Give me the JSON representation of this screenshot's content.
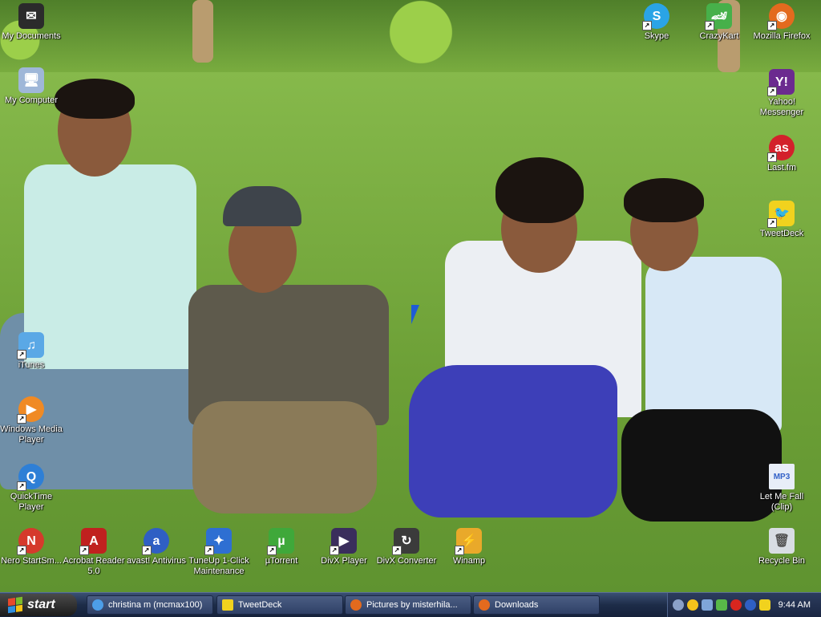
{
  "desktop_icons": [
    {
      "id": "my-documents",
      "label": "My Documents",
      "icon": "folder-icon",
      "color": "#2b2b2b"
    },
    {
      "id": "my-computer",
      "label": "My Computer",
      "icon": "computer-icon",
      "color": "#9fb7d8"
    },
    {
      "id": "itunes",
      "label": "iTunes",
      "icon": "itunes-icon",
      "color": "#5aa8e6"
    },
    {
      "id": "wmp",
      "label": "Windows Media Player",
      "icon": "media-player-icon",
      "color": "#f08a24"
    },
    {
      "id": "quicktime",
      "label": "QuickTime Player",
      "icon": "quicktime-icon",
      "color": "#2e7fd6"
    },
    {
      "id": "nero",
      "label": "Nero StartSm...",
      "icon": "nero-icon",
      "color": "#d53a2c"
    },
    {
      "id": "acrobat",
      "label": "Acrobat Reader 5.0",
      "icon": "acrobat-icon",
      "color": "#c0211f"
    },
    {
      "id": "avast",
      "label": "avast! Antivirus",
      "icon": "avast-icon",
      "color": "#2f5fc4"
    },
    {
      "id": "tuneup",
      "label": "TuneUp 1-Click Maintenance",
      "icon": "tuneup-icon",
      "color": "#2e6fd2"
    },
    {
      "id": "utorrent",
      "label": "µTorrent",
      "icon": "utorrent-icon",
      "color": "#3fa83a"
    },
    {
      "id": "divx-player",
      "label": "DivX Player",
      "icon": "divx-player-icon",
      "color": "#3a2e5c"
    },
    {
      "id": "divx-converter",
      "label": "DivX Converter",
      "icon": "divx-converter-icon",
      "color": "#3b3b3b"
    },
    {
      "id": "winamp",
      "label": "Winamp",
      "icon": "winamp-icon",
      "color": "#e9a92a"
    },
    {
      "id": "skype",
      "label": "Skype",
      "icon": "skype-icon",
      "color": "#2aa4e6"
    },
    {
      "id": "crazykart",
      "label": "CrazyKart",
      "icon": "kart-icon",
      "color": "#47b04a"
    },
    {
      "id": "firefox",
      "label": "Mozilla Firefox",
      "icon": "firefox-icon",
      "color": "#e36a1e"
    },
    {
      "id": "yahoo",
      "label": "Yahoo! Messenger",
      "icon": "yahoo-messenger-icon",
      "color": "#6b2a8f"
    },
    {
      "id": "lastfm",
      "label": "Last.fm",
      "icon": "lastfm-icon",
      "color": "#d3212b"
    },
    {
      "id": "tweetdeck",
      "label": "TweetDeck",
      "icon": "tweetdeck-icon",
      "color": "#f1d21e"
    },
    {
      "id": "mp3",
      "label": "Let Me Fall (Clip)",
      "icon": "mp3-file-icon",
      "color": "#e8eef8"
    },
    {
      "id": "recycle",
      "label": "Recycle Bin",
      "icon": "recycle-bin-icon",
      "color": "#d8dde3"
    }
  ],
  "taskbar": {
    "start_label": "start",
    "tasks": [
      {
        "label": "christina m (mcmax100)",
        "icon": "messenger-icon",
        "color": "#4d9ee8"
      },
      {
        "label": "TweetDeck",
        "icon": "tweetdeck-icon",
        "color": "#f1d21e"
      },
      {
        "label": "Pictures by misterhila...",
        "icon": "firefox-icon",
        "color": "#e36a1e"
      },
      {
        "label": "Downloads",
        "icon": "firefox-icon",
        "color": "#e36a1e"
      }
    ],
    "tray_icons": [
      "show-hidden-icon",
      "messenger-tray-icon",
      "network-icon",
      "tuneup-tray-icon",
      "antivirus-tray-icon",
      "avast-tray-icon",
      "tweetdeck-tray-icon"
    ],
    "clock": "9:44 AM"
  }
}
